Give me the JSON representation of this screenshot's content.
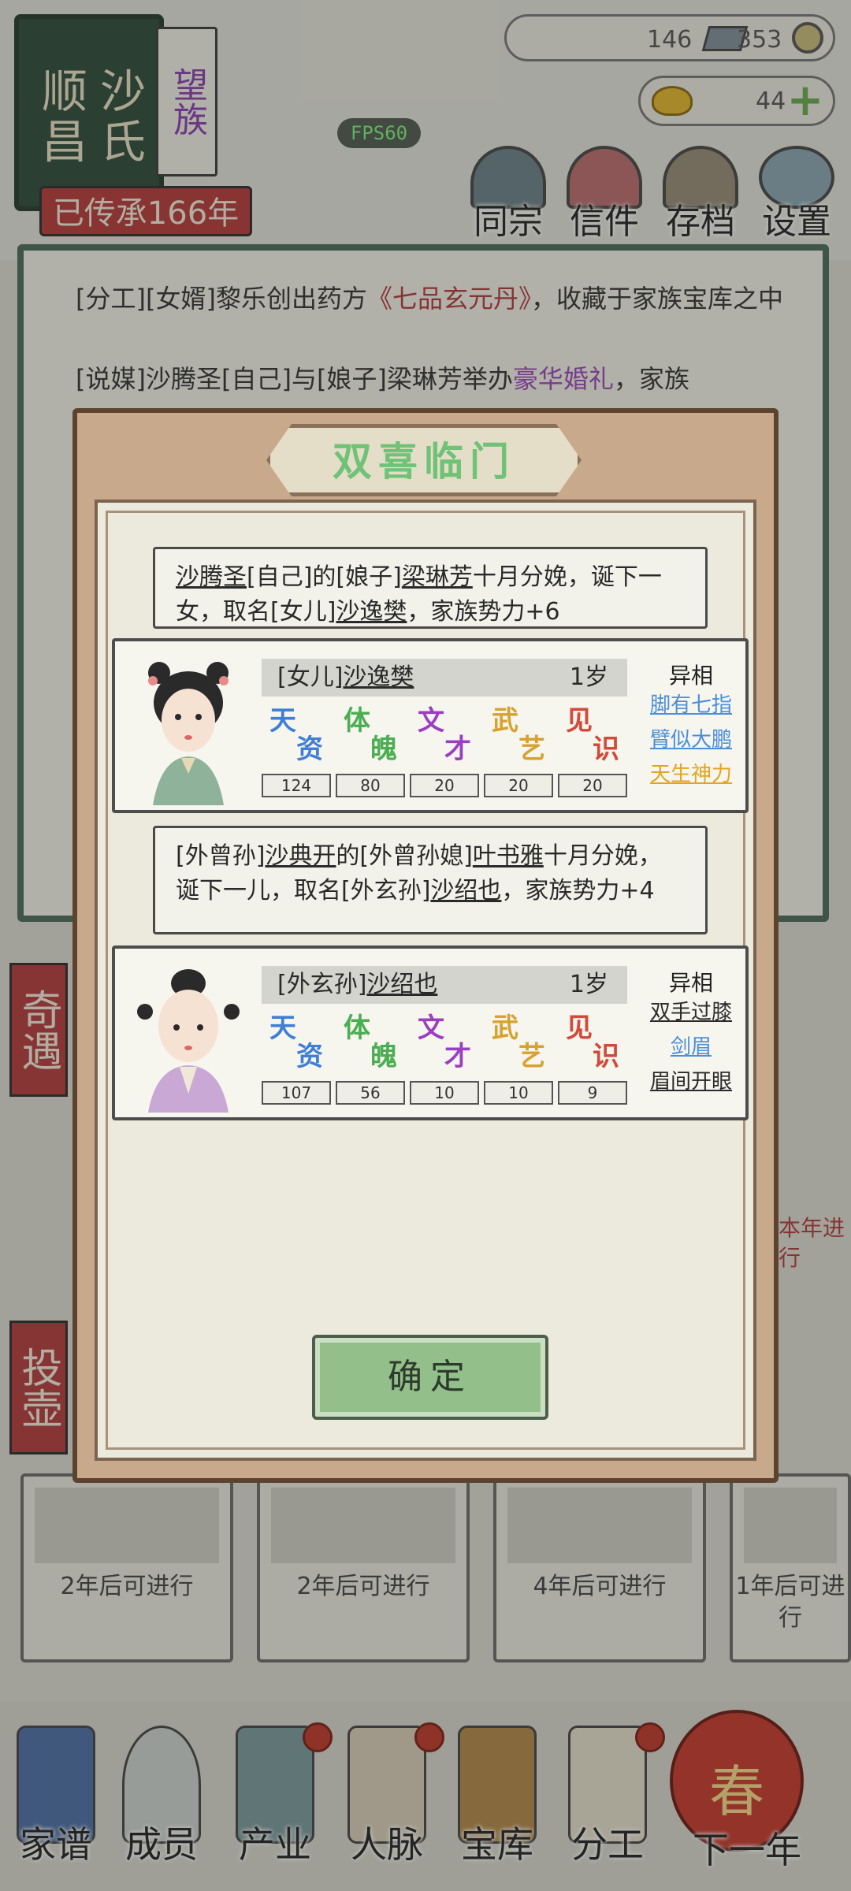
{
  "header": {
    "surname_label": "沙氏",
    "place_label": "顺昌",
    "clan_rank": "望族",
    "heritage": "已传承166年",
    "fps": "FPS60"
  },
  "resources": {
    "silver": "146",
    "copper": "353",
    "gold": "44"
  },
  "top_menu": [
    "同宗",
    "信件",
    "存档",
    "设置"
  ],
  "log": {
    "line1_prefix": "[分工][女婿]黎乐创出药方",
    "line1_highlight": "《七品玄元丹》",
    "line1_suffix": "，收藏于家族宝库之中",
    "line2_prefix": "[说媒]沙腾圣[自己]与[娘子]梁琳芳举办",
    "line2_highlight": "豪华婚礼",
    "line2_suffix": "，家族"
  },
  "side_tabs": [
    "奇遇",
    "投壶"
  ],
  "event_cards": [
    {
      "text": "2年后可进行"
    },
    {
      "text": "2年后可进行"
    },
    {
      "text": "4年后可进行"
    },
    {
      "text": "1年后可进行"
    }
  ],
  "side_event_text": "本年进行",
  "bottom_nav": [
    "家谱",
    "成员",
    "产业",
    "人脉",
    "宝库",
    "分工",
    "下一年"
  ],
  "spring_glyph": "春",
  "modal": {
    "title": "双喜临门",
    "confirm": "确定",
    "announcements": [
      {
        "parts": [
          "沙腾圣",
          "[自己]的[娘子]",
          "梁琳芳",
          "十月分娩，诞下一女，取名[女儿]",
          "沙逸樊",
          "，家族势力+6"
        ]
      },
      {
        "parts": [
          "[外曾孙]",
          "沙典开",
          "的[外曾孙媳]",
          "叶书雅",
          "十月分娩，诞下一儿，取名[外玄孙]",
          "沙绍也",
          "，家族势力+4"
        ]
      }
    ],
    "children": [
      {
        "title": "[女儿]",
        "name": "沙逸樊",
        "age": "1岁",
        "stats": [
          {
            "top": "天",
            "bottom": "资",
            "color": "#3f7fd6",
            "value": "124"
          },
          {
            "top": "体",
            "bottom": "魄",
            "color": "#4cae52",
            "value": "80"
          },
          {
            "top": "文",
            "bottom": "才",
            "color": "#9a3fc2",
            "value": "20"
          },
          {
            "top": "武",
            "bottom": "艺",
            "color": "#d6a231",
            "value": "20"
          },
          {
            "top": "见",
            "bottom": "识",
            "color": "#d14a3a",
            "value": "20"
          }
        ],
        "trait_header": "异相",
        "traits": [
          {
            "label": "脚有七指",
            "color": "#4a8fd9"
          },
          {
            "label": "臂似大鹏",
            "color": "#4a8fd9"
          },
          {
            "label": "天生神力",
            "color": "#e3a51f"
          }
        ]
      },
      {
        "title": "[外玄孙]",
        "name": "沙绍也",
        "age": "1岁",
        "stats": [
          {
            "top": "天",
            "bottom": "资",
            "color": "#3f7fd6",
            "value": "107"
          },
          {
            "top": "体",
            "bottom": "魄",
            "color": "#4cae52",
            "value": "56"
          },
          {
            "top": "文",
            "bottom": "才",
            "color": "#9a3fc2",
            "value": "10"
          },
          {
            "top": "武",
            "bottom": "艺",
            "color": "#d6a231",
            "value": "10"
          },
          {
            "top": "见",
            "bottom": "识",
            "color": "#d14a3a",
            "value": "9"
          }
        ],
        "trait_header": "异相",
        "traits": [
          {
            "label": "双手过膝",
            "color": "#2a2a2a"
          },
          {
            "label": "剑眉",
            "color": "#4a8fd9"
          },
          {
            "label": "眉间开眼",
            "color": "#2a2a2a"
          }
        ]
      }
    ]
  }
}
